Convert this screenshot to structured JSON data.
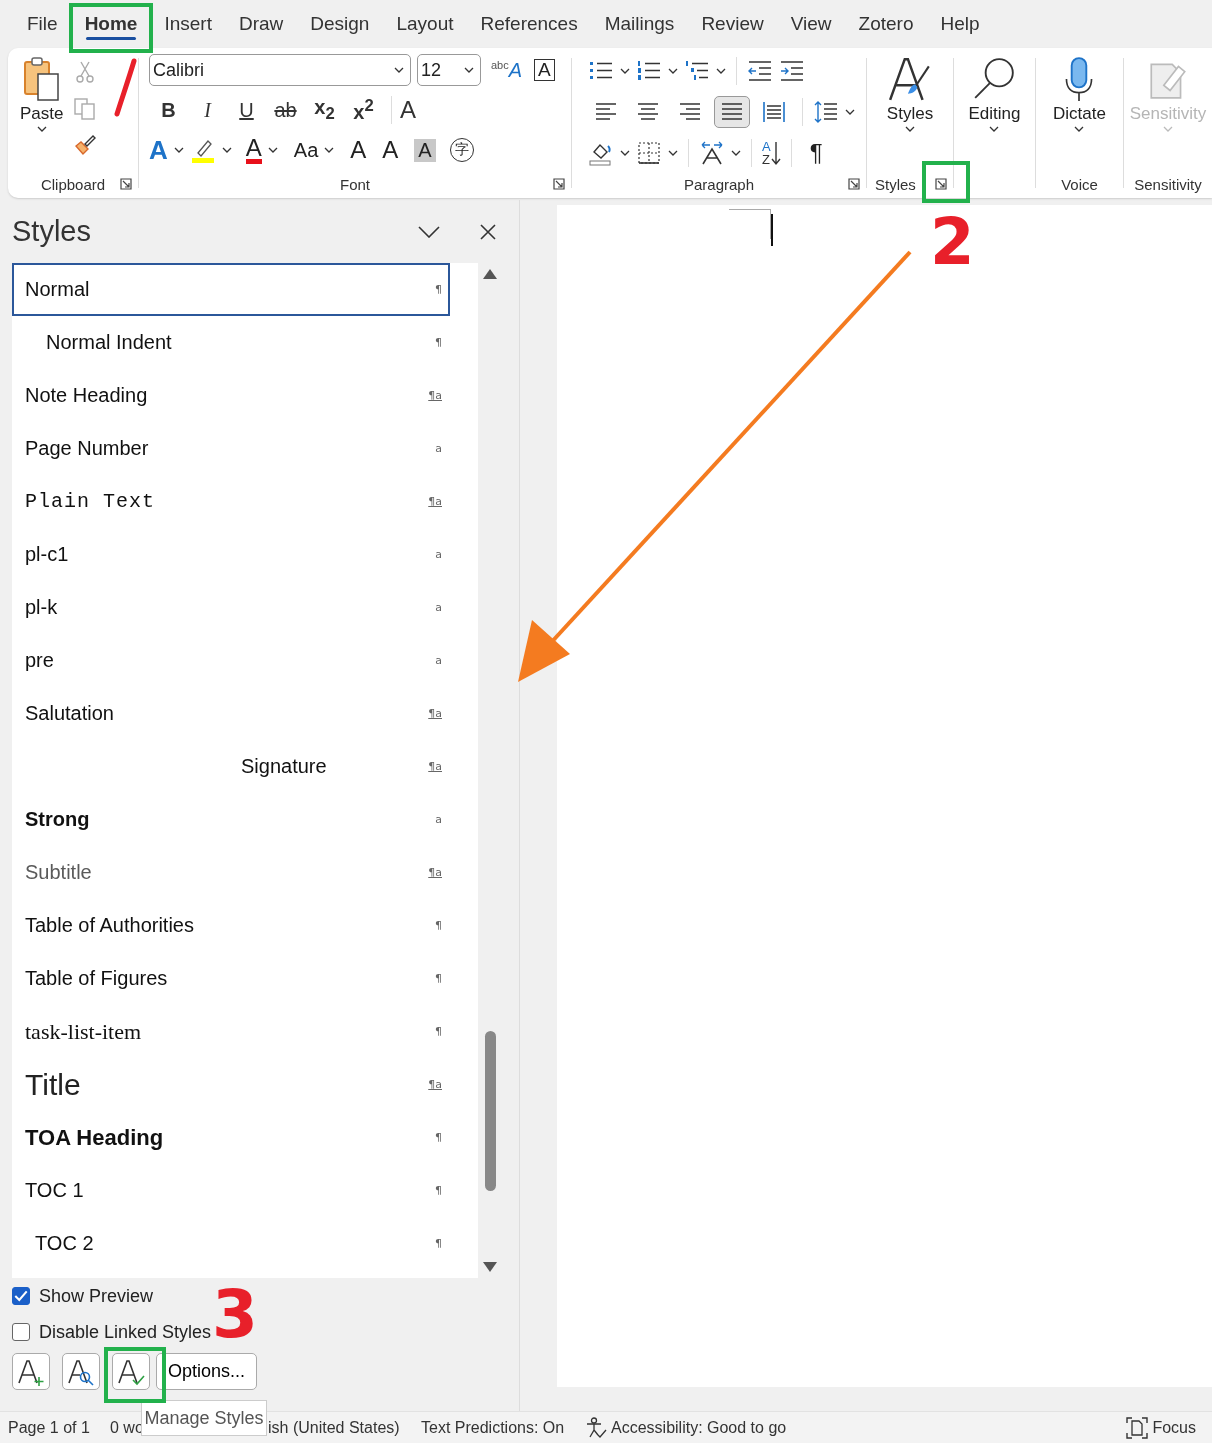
{
  "menu_tabs": [
    {
      "label": "File",
      "selected": false
    },
    {
      "label": "Home",
      "selected": true
    },
    {
      "label": "Insert",
      "selected": false
    },
    {
      "label": "Draw",
      "selected": false
    },
    {
      "label": "Design",
      "selected": false
    },
    {
      "label": "Layout",
      "selected": false
    },
    {
      "label": "References",
      "selected": false
    },
    {
      "label": "Mailings",
      "selected": false
    },
    {
      "label": "Review",
      "selected": false
    },
    {
      "label": "View",
      "selected": false
    },
    {
      "label": "Zotero",
      "selected": false
    },
    {
      "label": "Help",
      "selected": false
    }
  ],
  "ribbon": {
    "clipboard": {
      "paste": "Paste",
      "label": "Clipboard"
    },
    "font": {
      "name": "Calibri",
      "size": "12",
      "phonetic_top": "abc",
      "phonetic_main": "A",
      "border_char": "A",
      "format_buttons": [
        "B",
        "I",
        "U",
        "ab",
        "x$_{2}$",
        "x$^{2}$"
      ],
      "clear": "A",
      "effects": "A",
      "font_color": "A",
      "case": "Aa",
      "grow": "A",
      "shrink": "A",
      "shading": "A",
      "enclose": "字",
      "label": "Font"
    },
    "paragraph": {
      "alignment": [
        {
          "selected": false
        },
        {
          "selected": false
        },
        {
          "selected": false
        },
        {
          "selected": true
        },
        {
          "selected": false
        }
      ],
      "sort_top": "A",
      "sort_bottom": "Z",
      "pilcrow": "¶",
      "label": "Paragraph"
    },
    "styles": {
      "button": "Styles",
      "label": "Styles"
    },
    "editing": {
      "button": "Editing"
    },
    "voice": {
      "button": "Dictate",
      "label": "Voice"
    },
    "sensitivity": {
      "button": "Sensitivity",
      "label": "Sensitivity",
      "disabled": true
    }
  },
  "styles_pane": {
    "title": "Styles",
    "items": [
      {
        "name": "Normal",
        "kind": "plain",
        "mark": "¶",
        "linked": false,
        "selected": true
      },
      {
        "name": "Normal Indent",
        "kind": "indent",
        "mark": "¶",
        "linked": false,
        "selected": false
      },
      {
        "name": "Note Heading",
        "kind": "plain",
        "mark": "¶a",
        "linked": true,
        "selected": false
      },
      {
        "name": "Page Number",
        "kind": "plain",
        "mark": "a",
        "linked": false,
        "selected": false
      },
      {
        "name": "Plain Text",
        "kind": "mono",
        "mark": "¶a",
        "linked": true,
        "selected": false
      },
      {
        "name": "pl-c1",
        "kind": "plain",
        "mark": "a",
        "linked": false,
        "selected": false
      },
      {
        "name": "pl-k",
        "kind": "plain",
        "mark": "a",
        "linked": false,
        "selected": false
      },
      {
        "name": "pre",
        "kind": "plain",
        "mark": "a",
        "linked": false,
        "selected": false
      },
      {
        "name": "Salutation",
        "kind": "plain",
        "mark": "¶a",
        "linked": true,
        "selected": false
      },
      {
        "name": "Signature",
        "kind": "signature",
        "mark": "¶a",
        "linked": true,
        "selected": false
      },
      {
        "name": "Strong",
        "kind": "bold",
        "mark": "a",
        "linked": false,
        "selected": false
      },
      {
        "name": "Subtitle",
        "kind": "subtitle",
        "mark": "¶a",
        "linked": true,
        "selected": false
      },
      {
        "name": "Table of Authorities",
        "kind": "plain",
        "mark": "¶",
        "linked": false,
        "selected": false
      },
      {
        "name": "Table of Figures",
        "kind": "plain",
        "mark": "¶",
        "linked": false,
        "selected": false
      },
      {
        "name": "task-list-item",
        "kind": "serif",
        "mark": "¶",
        "linked": false,
        "selected": false
      },
      {
        "name": "Title",
        "kind": "title",
        "mark": "¶a",
        "linked": true,
        "selected": false
      },
      {
        "name": "TOA Heading",
        "kind": "heading",
        "mark": "¶",
        "linked": false,
        "selected": false
      },
      {
        "name": "TOC 1",
        "kind": "plain",
        "mark": "¶",
        "linked": false,
        "selected": false
      },
      {
        "name": "TOC 2",
        "kind": "toc2",
        "mark": "¶",
        "linked": false,
        "selected": false
      }
    ],
    "show_preview": {
      "label": "Show Preview",
      "checked": true
    },
    "disable_linked": {
      "label": "Disable Linked Styles",
      "checked": false
    },
    "options": "Options...",
    "tooltip": "Manage Styles"
  },
  "status_bar": [
    "Page 1 of 1",
    "0 wo",
    "ish (United States)",
    "Text Predictions: On",
    "Accessibility: Good to go",
    "Focus"
  ],
  "annotations": [
    "2",
    "3"
  ]
}
